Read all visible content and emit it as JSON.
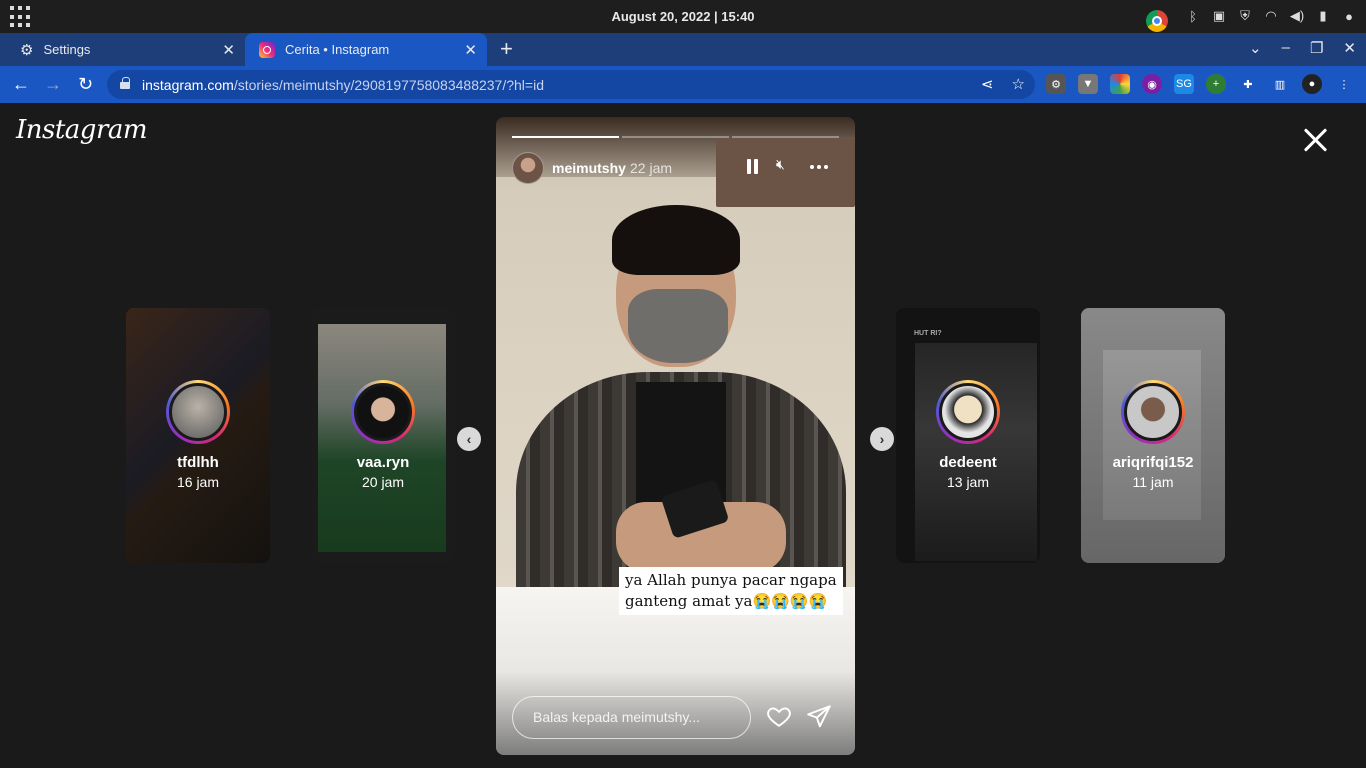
{
  "os": {
    "clock": "August 20, 2022 | 15:40"
  },
  "tabs": [
    {
      "label": "Settings",
      "icon": "gear-icon"
    },
    {
      "label": "Cerita • Instagram",
      "icon": "instagram-icon",
      "active": true
    }
  ],
  "address": {
    "host": "instagram.com",
    "path": "/stories/meimutshy/2908197758083488237/?hl=id"
  },
  "page": {
    "logo": "Instagram",
    "story": {
      "username": "meimutshy",
      "time": "22 jam",
      "caption_lines": [
        "ya Allah punya pacar ngapa",
        "ganteng amat ya😭😭😭😭"
      ],
      "reply_placeholder": "Balas kepada meimutshy...",
      "progress": [
        1.0,
        0.0,
        0.0
      ]
    },
    "previews": [
      {
        "name": "tfdlhh",
        "time": "16 jam"
      },
      {
        "name": "vaa.ryn",
        "time": "20 jam"
      },
      {
        "name": "dedeent",
        "time": "13 jam"
      },
      {
        "name": "ariqrifqi152",
        "time": "11 jam"
      }
    ],
    "preview_text": {
      "hut": "HUT RI?"
    }
  },
  "colors": {
    "tabbar": "#1d3e78",
    "active_tab": "#1b57c2",
    "page_bg": "#1a1a1a"
  }
}
